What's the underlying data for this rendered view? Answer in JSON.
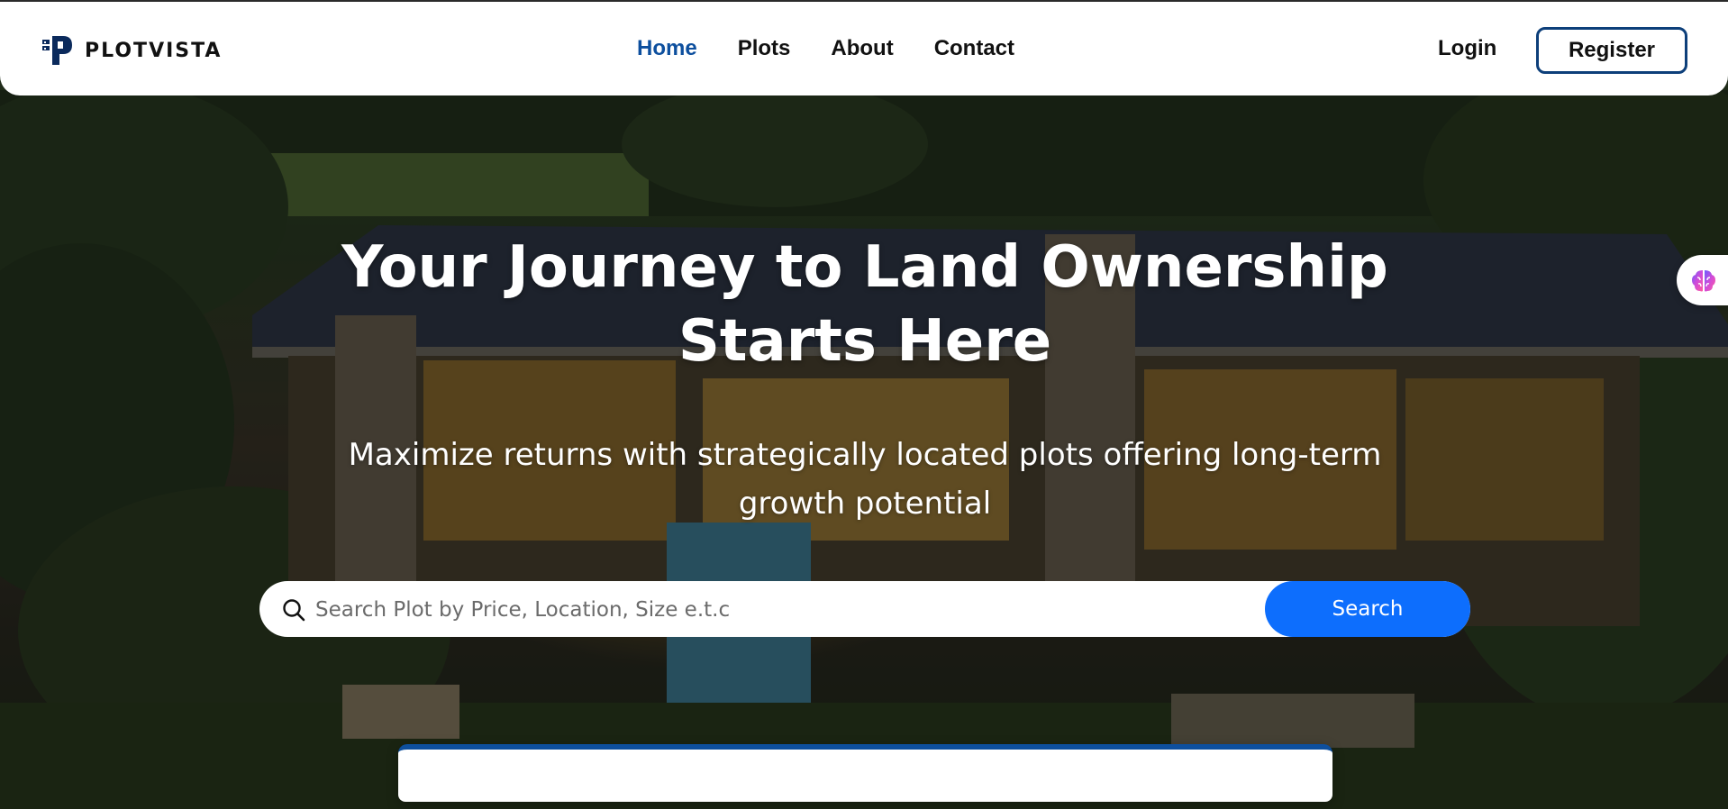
{
  "brand": {
    "name": "PLOTVISTA",
    "logo_icon": "plotvista-logo-icon",
    "color": "#0b2a5c"
  },
  "nav": {
    "links": [
      {
        "label": "Home",
        "active": true
      },
      {
        "label": "Plots",
        "active": false
      },
      {
        "label": "About",
        "active": false
      },
      {
        "label": "Contact",
        "active": false
      }
    ],
    "active_color": "#0d4f9e",
    "login_label": "Login",
    "register_label": "Register"
  },
  "hero": {
    "title_line1": "Your Journey to Land Ownership",
    "title_line2": "Starts Here",
    "subtitle_line1": "Maximize returns with strategically located plots offering long-term",
    "subtitle_line2": "growth potential"
  },
  "search": {
    "placeholder": "Search Plot by Price, Location, Size e.t.c",
    "value": "",
    "button_label": "Search",
    "button_color": "#0d6efd",
    "icon": "search-icon"
  },
  "floating_widget": {
    "icon": "brain-icon"
  }
}
